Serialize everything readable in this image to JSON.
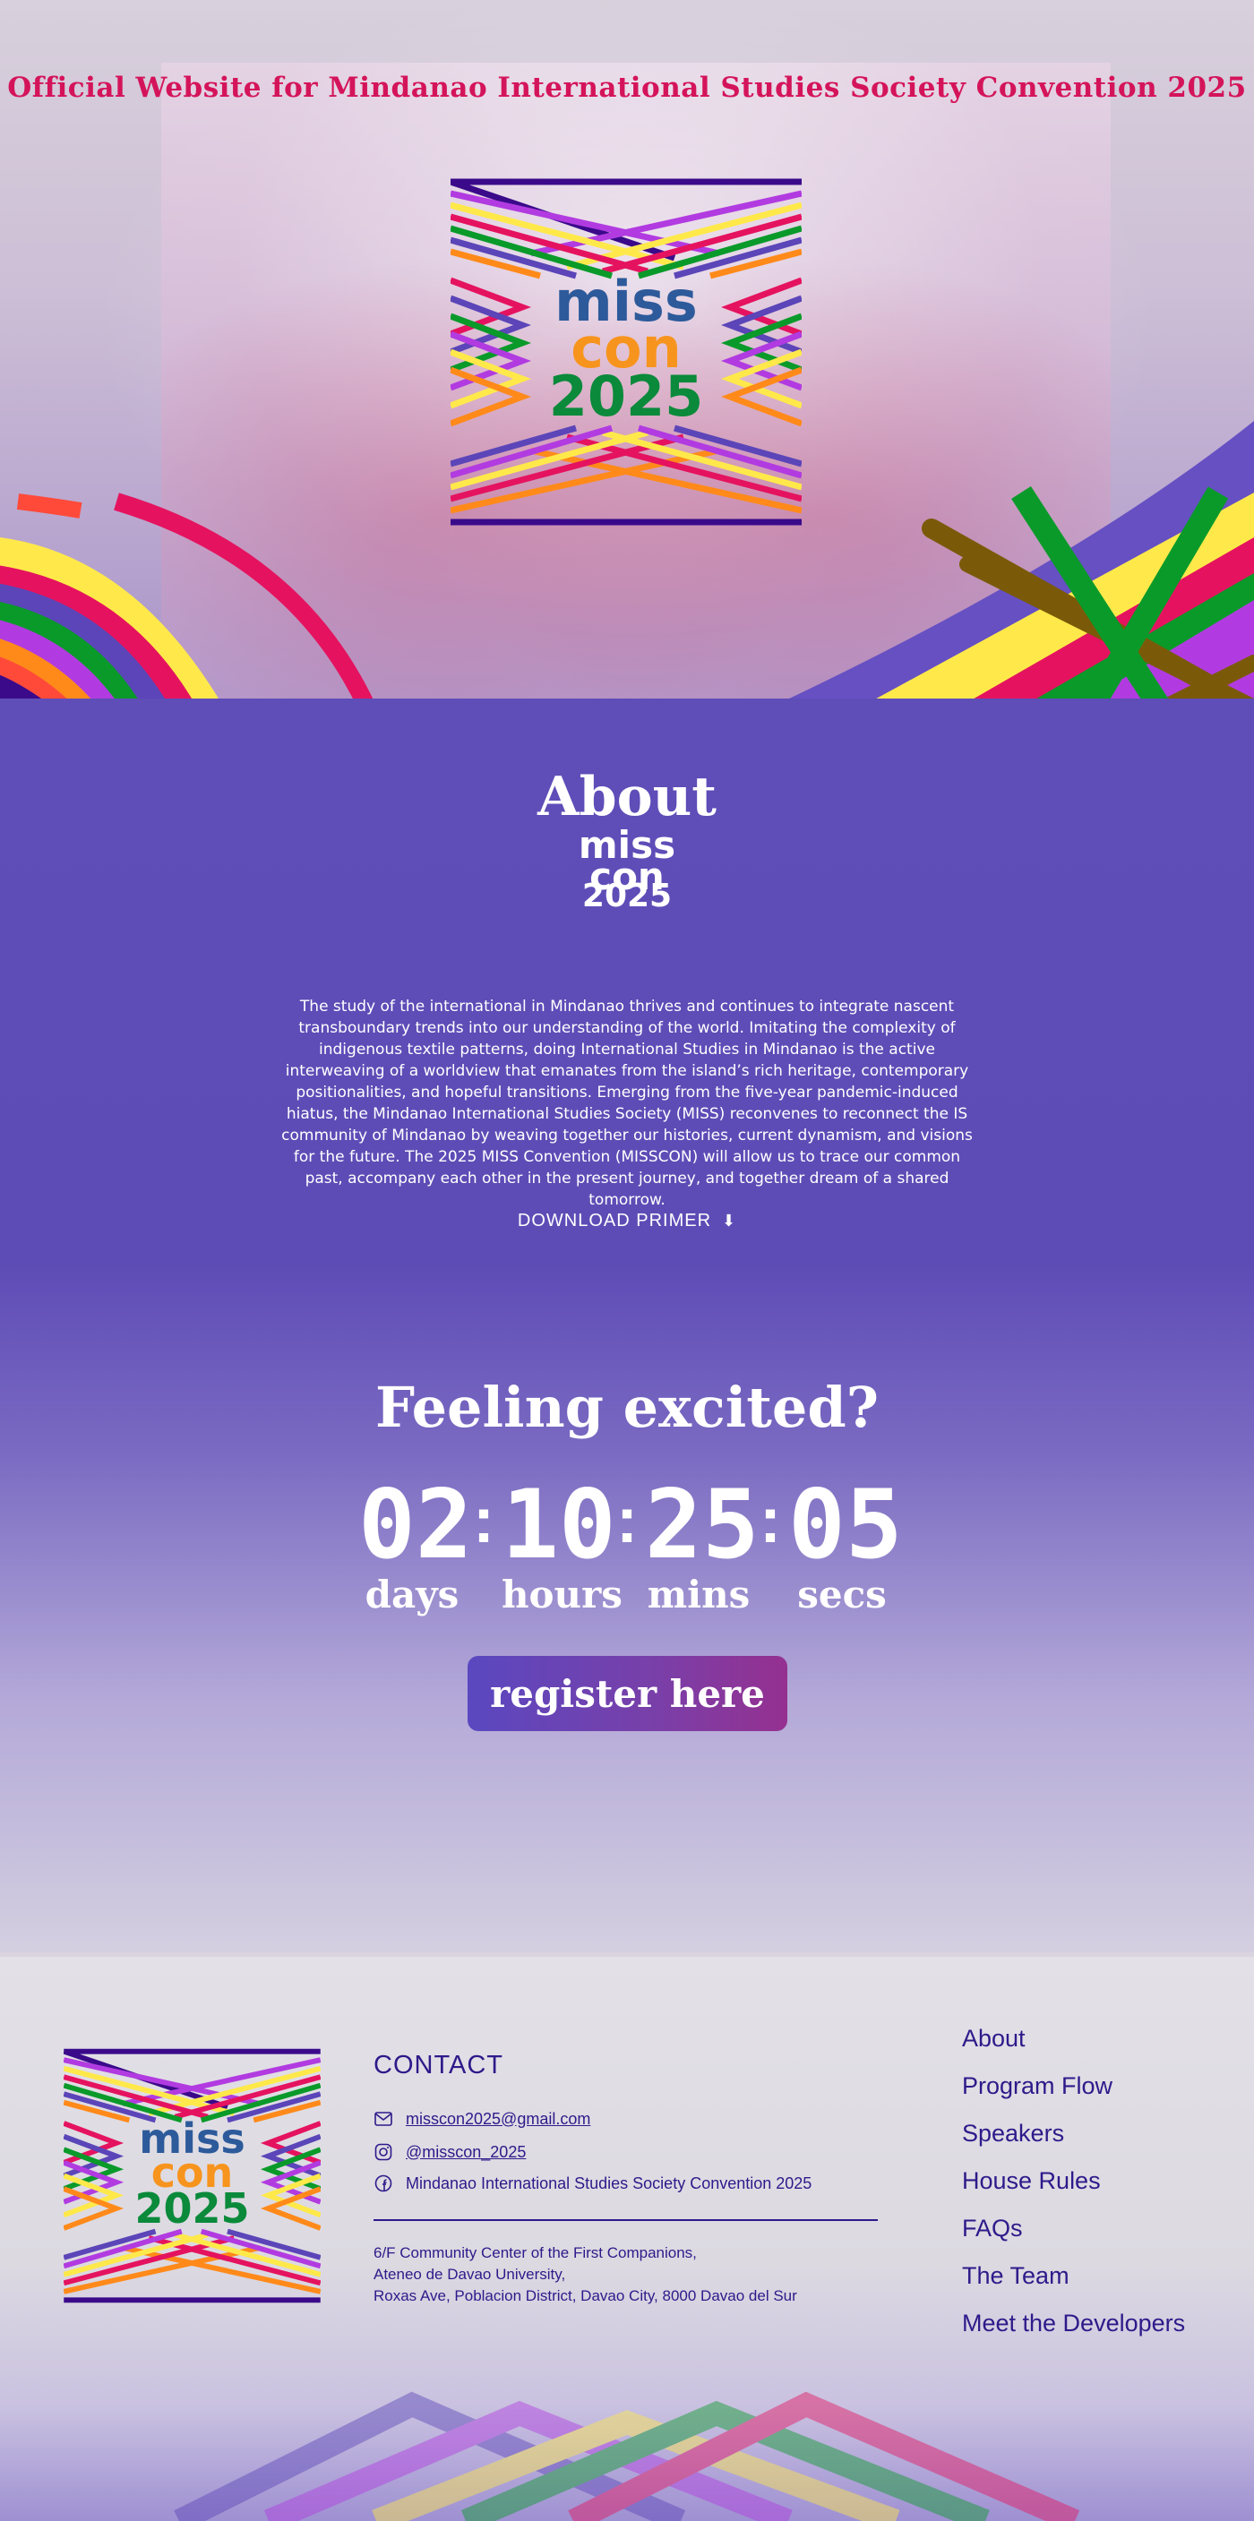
{
  "header": {
    "title": "Official Website for Mindanao International Studies Society Convention 2025"
  },
  "logo": {
    "line1": "miss",
    "line2": "con",
    "line3": "2025",
    "colors": {
      "miss": "#2d5a9a",
      "con": "#f7941d",
      "year": "#0a8a3a"
    }
  },
  "about": {
    "heading": "About",
    "logo_line1": "miss",
    "logo_line2": "con",
    "logo_line3": "2025",
    "body": "The study of the international in Mindanao thrives and continues to integrate nascent transboundary trends into our understanding of the world. Imitating the complexity of indigenous textile patterns, doing International Studies in Mindanao is the active interweaving of a worldview that emanates from the island’s rich heritage, contemporary positionalities, and hopeful transitions. Emerging from the five-year pandemic-induced hiatus, the Mindanao International Studies Society (MISS) reconvenes to reconnect the IS community of Mindanao by weaving together our histories, current dynamism, and visions for the future. The 2025 MISS Convention (MISSCON) will allow us to trace our common past, accompany each other in the present journey, and together dream of a shared tomorrow.",
    "download_label": "DOWNLOAD PRIMER",
    "download_icon": "download-icon"
  },
  "countdown": {
    "heading": "Feeling excited?",
    "days": "02",
    "hours": "10",
    "mins": "25",
    "secs": "05",
    "days_label": "days",
    "hours_label": "hours",
    "mins_label": "mins",
    "secs_label": "secs",
    "separator": ":",
    "register_label": "register here"
  },
  "footer": {
    "contact_heading": "CONTACT",
    "email": "misscon2025@gmail.com",
    "instagram": "@misscon_2025",
    "facebook": "Mindanao International Studies Society Convention 2025",
    "address_line1": "6/F Community Center of the First Companions,",
    "address_line2": "Ateneo de Davao University,",
    "address_line3": "Roxas Ave, Poblacion District, Davao City, 8000 Davao del Sur",
    "nav": [
      "About",
      "Program Flow",
      "Speakers",
      "House Rules",
      "FAQs",
      "The Team",
      "Meet the Developers"
    ]
  },
  "colors": {
    "accent_purple": "#5e4cb6",
    "title_pink": "#d4145a",
    "footer_text": "#2e1a8a"
  }
}
